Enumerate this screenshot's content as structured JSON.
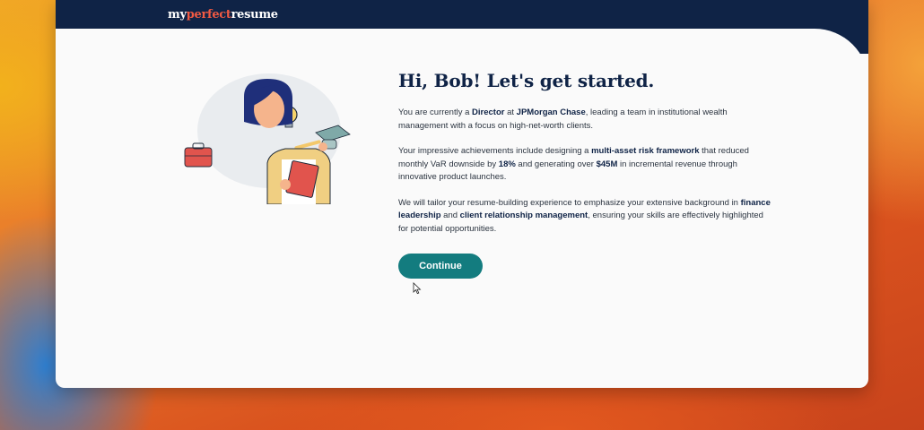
{
  "header": {
    "logo_part1": "my",
    "logo_part2": "perfect",
    "logo_part3": "resume"
  },
  "main": {
    "headline": "Hi, Bob! Let's get started.",
    "p1": {
      "t1": "You are currently a ",
      "b1": "Director",
      "t2": " at ",
      "b2": "JPMorgan Chase",
      "t3": ", leading a team in institutional wealth management with a focus on high-net-worth clients."
    },
    "p2": {
      "t1": "Your impressive achievements include designing a ",
      "b1": "multi-asset risk framework",
      "t2": " that reduced monthly VaR downside by ",
      "b2": "18%",
      "t3": " and generating over ",
      "b3": "$45M",
      "t4": " in incremental revenue through innovative product launches."
    },
    "p3": {
      "t1": "We will tailor your resume-building experience to emphasize your extensive background in ",
      "b1": "finance leadership",
      "t2": " and ",
      "b2": "client relationship management",
      "t3": ", ensuring your skills are effectively highlighted for potential opportunities."
    },
    "continue_label": "Continue"
  },
  "colors": {
    "navy": "#0f2346",
    "teal": "#137c7f",
    "brand_red": "#f15a43"
  }
}
